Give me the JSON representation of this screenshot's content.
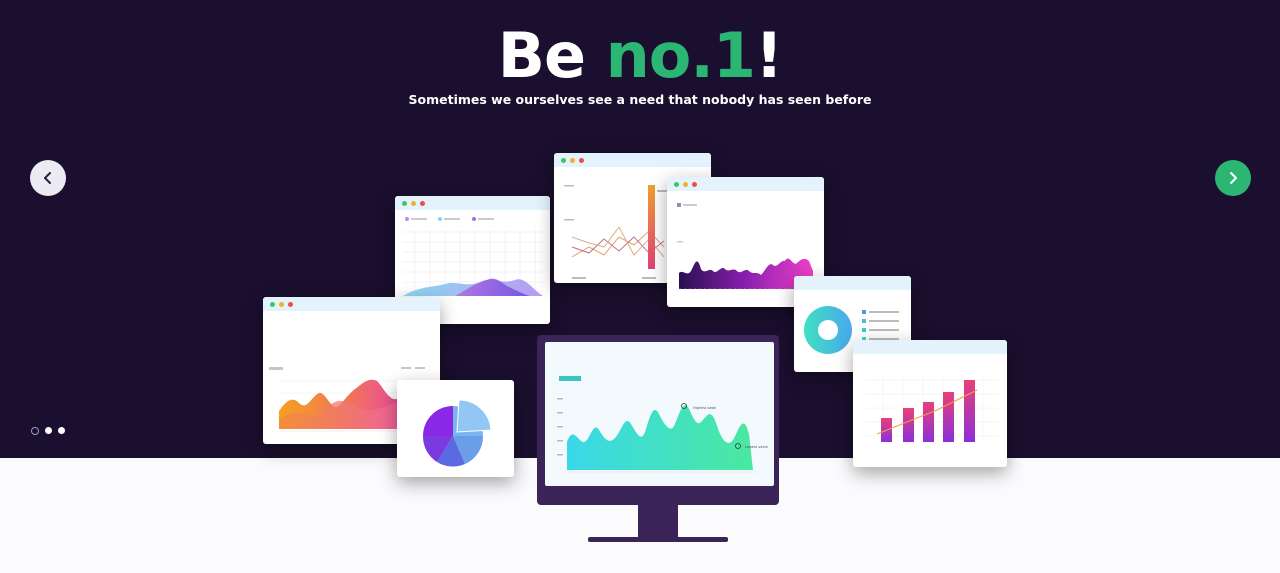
{
  "hero": {
    "title_main": "Be ",
    "title_highlight": "no.1",
    "title_end": "!",
    "subtitle": "Sometimes we ourselves see a need that nobody has seen before",
    "highlight_color": "#2bb673",
    "background_color": "#1a0f2e"
  },
  "carousel": {
    "prev_icon": "chevron-left-icon",
    "next_icon": "chevron-right-icon",
    "slide_count": 3,
    "active_slide": 1
  },
  "illustration": {
    "monitor_labels": {
      "peak": "Highest peak",
      "low": "Lowest value"
    }
  }
}
